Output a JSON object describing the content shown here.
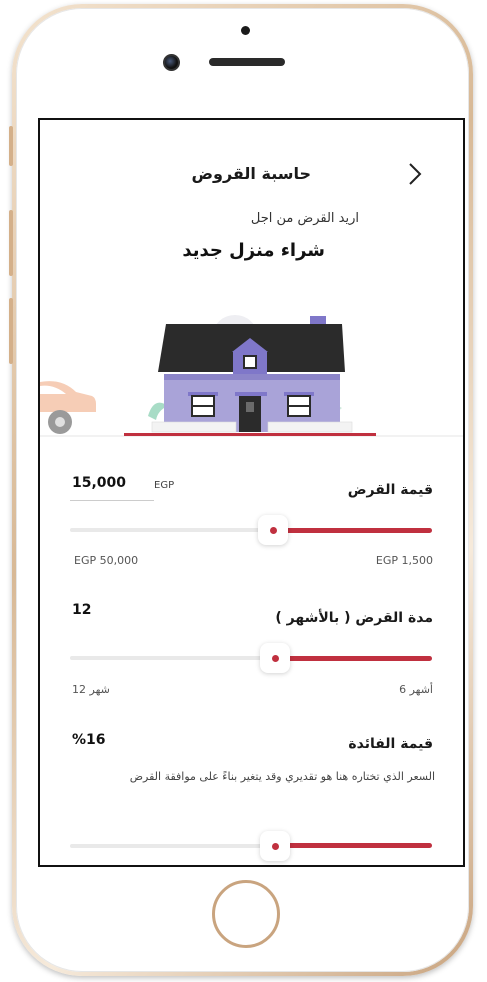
{
  "header": {
    "title": "حاسبة القروض"
  },
  "purpose": {
    "label": "اريد القرض من اجل",
    "value": "شراء منزل جديد"
  },
  "loan_amount": {
    "title": "قيمة القرض",
    "value": "15,000",
    "currency": "EGP",
    "min_label": "EGP 1,500",
    "max_label": "EGP 50,000",
    "slider_level_fraction": 0.42
  },
  "loan_term": {
    "title": "مدة القرض ( بالأشهر )",
    "value": "12",
    "min_label": "6 أشهر",
    "max_label": "12 شهر",
    "slider_level_fraction": 0.42
  },
  "interest": {
    "title": "قيمة الفائدة",
    "value": "%16",
    "note": "السعر الذي تختاره هنا هو تقديري وقد يتغير بناءً على موافقة القرض",
    "slider_level_fraction": 0.42
  },
  "colors": {
    "accent": "#c0303f",
    "house": "#a9a3d8",
    "roof": "#2b2b2b"
  },
  "icons": [
    "chevron-right-icon",
    "house-illustration",
    "car-illustration"
  ]
}
